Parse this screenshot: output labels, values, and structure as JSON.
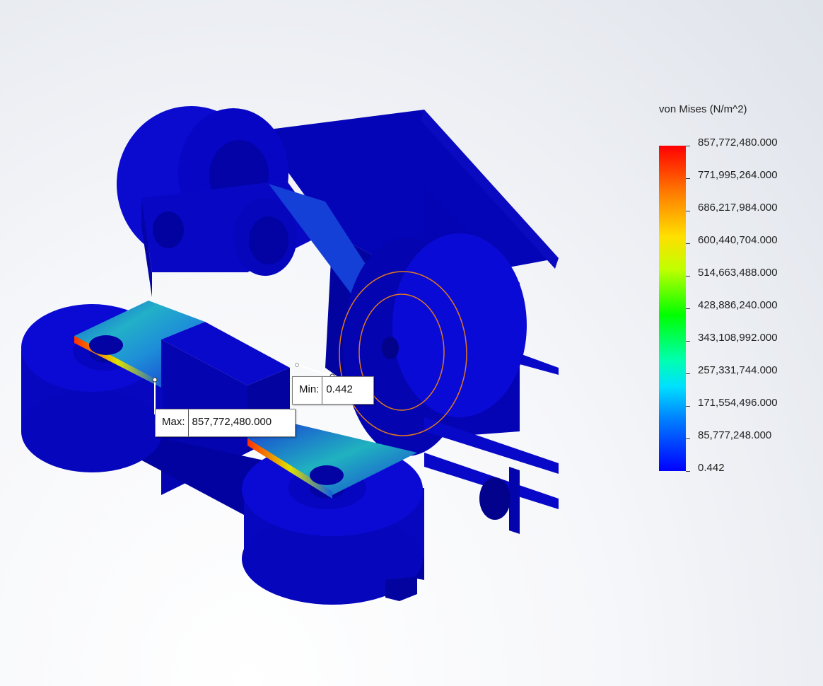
{
  "legend": {
    "title": "von Mises (N/m^2)",
    "ticks": [
      "857,772,480.000",
      "771,995,264.000",
      "686,217,984.000",
      "600,440,704.000",
      "514,663,488.000",
      "428,886,240.000",
      "343,108,992.000",
      "257,331,744.000",
      "171,554,496.000",
      "85,777,248.000",
      "0.442"
    ],
    "colors": [
      "#ff0000",
      "#ff8000",
      "#ffe000",
      "#00ff00",
      "#00ffff",
      "#0080ff",
      "#0000ff"
    ]
  },
  "probes": {
    "min": {
      "label": "Min:",
      "value": "0.442"
    },
    "max": {
      "label": "Max:",
      "value": "857,772,480.000"
    }
  },
  "model": {
    "base_color": "#0a0ad8",
    "highlight_color": "#e07820"
  }
}
